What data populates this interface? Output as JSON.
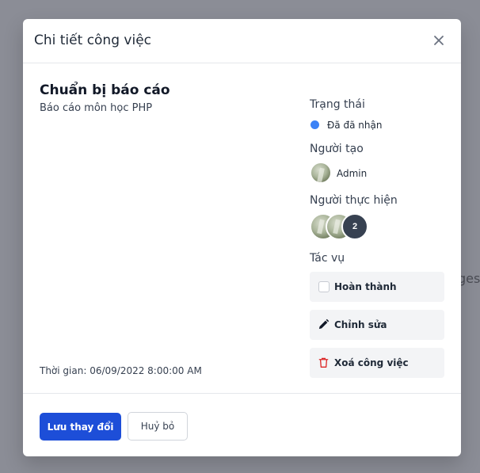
{
  "background": {
    "partial_text": "ges"
  },
  "modal": {
    "title": "Chi tiết công việc",
    "close_icon": "close-icon"
  },
  "task": {
    "title": "Chuẩn bị báo cáo",
    "description": "Báo cáo môn học PHP",
    "time": "Thời gian: 06/09/2022 8:00:00 AM"
  },
  "sidebar": {
    "status_label": "Trạng thái",
    "status_value": "Đã đã nhận",
    "status_color": "#3b82f6",
    "creator_label": "Người tạo",
    "creator_name": "Admin",
    "assignees_label": "Người thực hiện",
    "assignees_count": "2",
    "actions_label": "Tác vụ",
    "actions": [
      {
        "label": "Hoàn thành",
        "icon": "checkbox-icon"
      },
      {
        "label": "Chỉnh sửa",
        "icon": "pencil-icon"
      },
      {
        "label": "Xoá công việc",
        "icon": "trash-icon"
      }
    ]
  },
  "footer": {
    "save_label": "Lưu thay đổi",
    "cancel_label": "Huỷ bỏ",
    "primary_color": "#1d4ed8"
  }
}
